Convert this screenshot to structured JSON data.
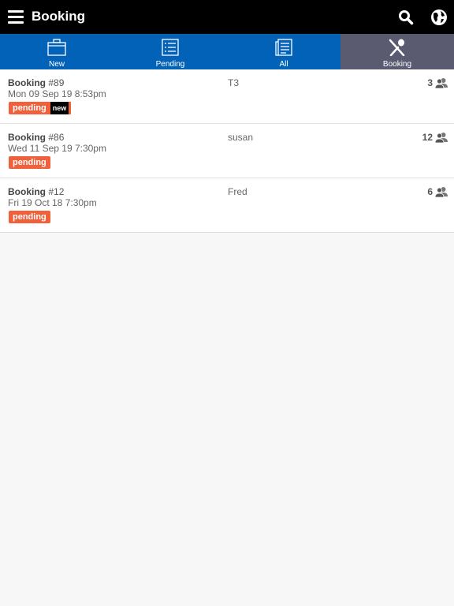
{
  "header": {
    "title": "Booking",
    "menu_icon": "hamburger-menu-icon",
    "actions": [
      "search-icon",
      "globe-icon"
    ]
  },
  "tabs": [
    {
      "label": "New",
      "icon": "briefcase-icon",
      "active": false
    },
    {
      "label": "Pending",
      "icon": "list-icon",
      "active": false
    },
    {
      "label": "All",
      "icon": "documents-icon",
      "active": false
    },
    {
      "label": "Booking",
      "icon": "fork-spoon-icon",
      "active": true
    }
  ],
  "bookings": [
    {
      "label": "Booking",
      "number": "#89",
      "date": "Mon 09 Sep 19 8:53pm",
      "status": "pending",
      "new_badge": "new",
      "name": "T3",
      "guests": "3"
    },
    {
      "label": "Booking",
      "number": "#86",
      "date": "Wed 11 Sep 19 7:30pm",
      "status": "pending",
      "new_badge": null,
      "name": "susan",
      "guests": "12"
    },
    {
      "label": "Booking",
      "number": "#12",
      "date": "Fri 19 Oct 18 7:30pm",
      "status": "pending",
      "new_badge": null,
      "name": "Fred",
      "guests": "6"
    }
  ],
  "colors": {
    "topbar": "#000000",
    "tabbar": "#0262b8",
    "active_tab": "#5a5a70",
    "pending": "#f0603a"
  }
}
